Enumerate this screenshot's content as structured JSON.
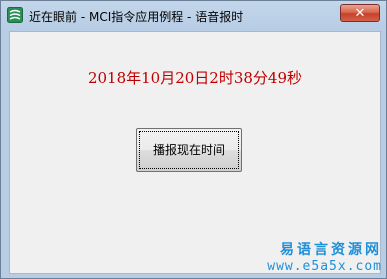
{
  "window": {
    "title": "近在眼前 - MCI指令应用例程 - 语音报时",
    "close_symbol": "✕"
  },
  "main": {
    "time_text": "2018年10月20日2时38分49秒",
    "announce_button": "播报现在时间"
  },
  "watermark": {
    "site_name": "易语言资源网",
    "url": "www.e5a5x.com"
  },
  "colors": {
    "time_text": "#c00000",
    "watermark": "#1f8fd8",
    "close_button": "#c7412a"
  },
  "icons": {
    "app": "app-icon",
    "close": "close-icon"
  }
}
